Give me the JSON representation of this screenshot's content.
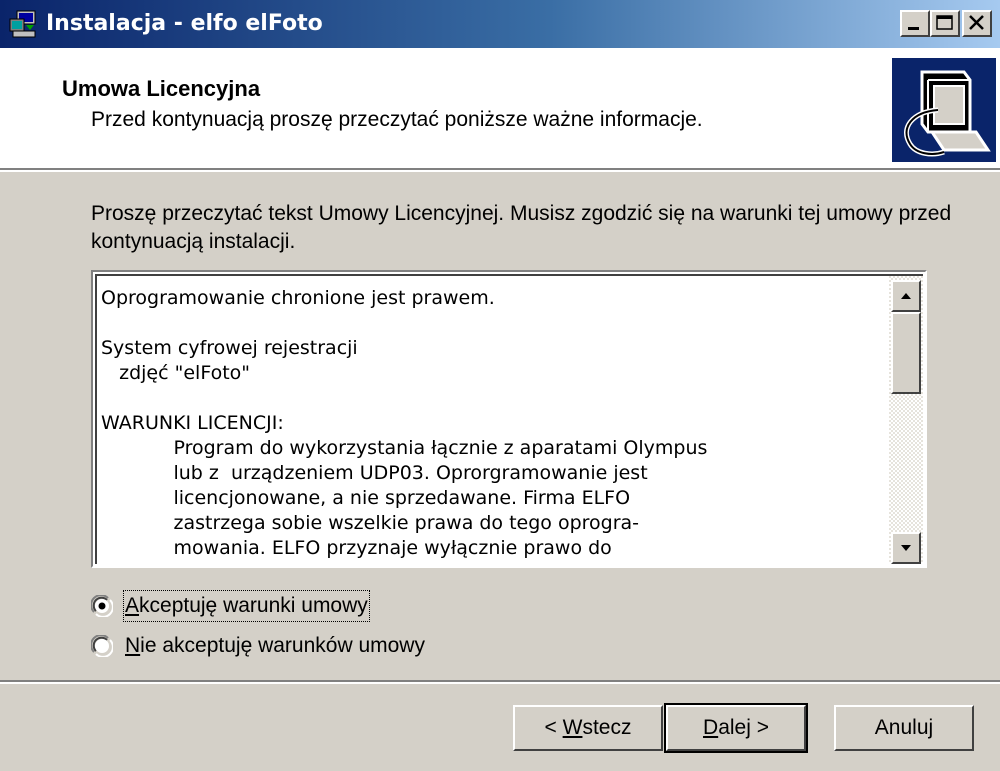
{
  "window": {
    "title": "Instalacja - elfo elFoto"
  },
  "title_buttons": {
    "minimize_icon": "minimize-icon",
    "maximize_icon": "maximize-icon",
    "close_icon": "close-icon"
  },
  "header": {
    "title": "Umowa Licencyjna",
    "subtitle": "Przed kontynuacją proszę przeczytać poniższe ważne informacje.",
    "image_icon": "installer-computer-icon"
  },
  "intro": "Proszę przeczytać tekst Umowy Licencyjnej. Musisz zgodzić się na warunki tej umowy przed kontynuacją instalacji.",
  "license": {
    "lines": [
      "Oprogramowanie chronione jest prawem.",
      "",
      "System cyfrowej rejestracji",
      "   zdjęć \"elFoto\"",
      "",
      "WARUNKI LICENCJI:",
      "            Program do wykorzystania łącznie z aparatami Olympus",
      "            lub z  urządzeniem UDP03. Oprorgramowanie jest",
      "            licencjonowane, a nie sprzedawane. Firma ELFO",
      "            zastrzega sobie wszelkie prawa do tego oprogra-",
      "            mowania. ELFO przyznaje wyłącznie prawo do"
    ]
  },
  "radios": {
    "accept": {
      "mnemonic": "A",
      "rest": "kceptuję warunki umowy",
      "checked": true
    },
    "decline": {
      "mnemonic": "N",
      "rest": "ie akceptuję warunków umowy",
      "checked": false
    }
  },
  "buttons": {
    "back": {
      "prefix": "< ",
      "mnemonic": "W",
      "rest": "stecz"
    },
    "next": {
      "mnemonic": "D",
      "rest": "alej >"
    },
    "cancel": {
      "label": "Anuluj"
    }
  },
  "colors": {
    "face": "#d4d0c8",
    "titlebar_start": "#0a246a",
    "titlebar_end": "#a6caf0",
    "header_bg": "#ffffff"
  }
}
